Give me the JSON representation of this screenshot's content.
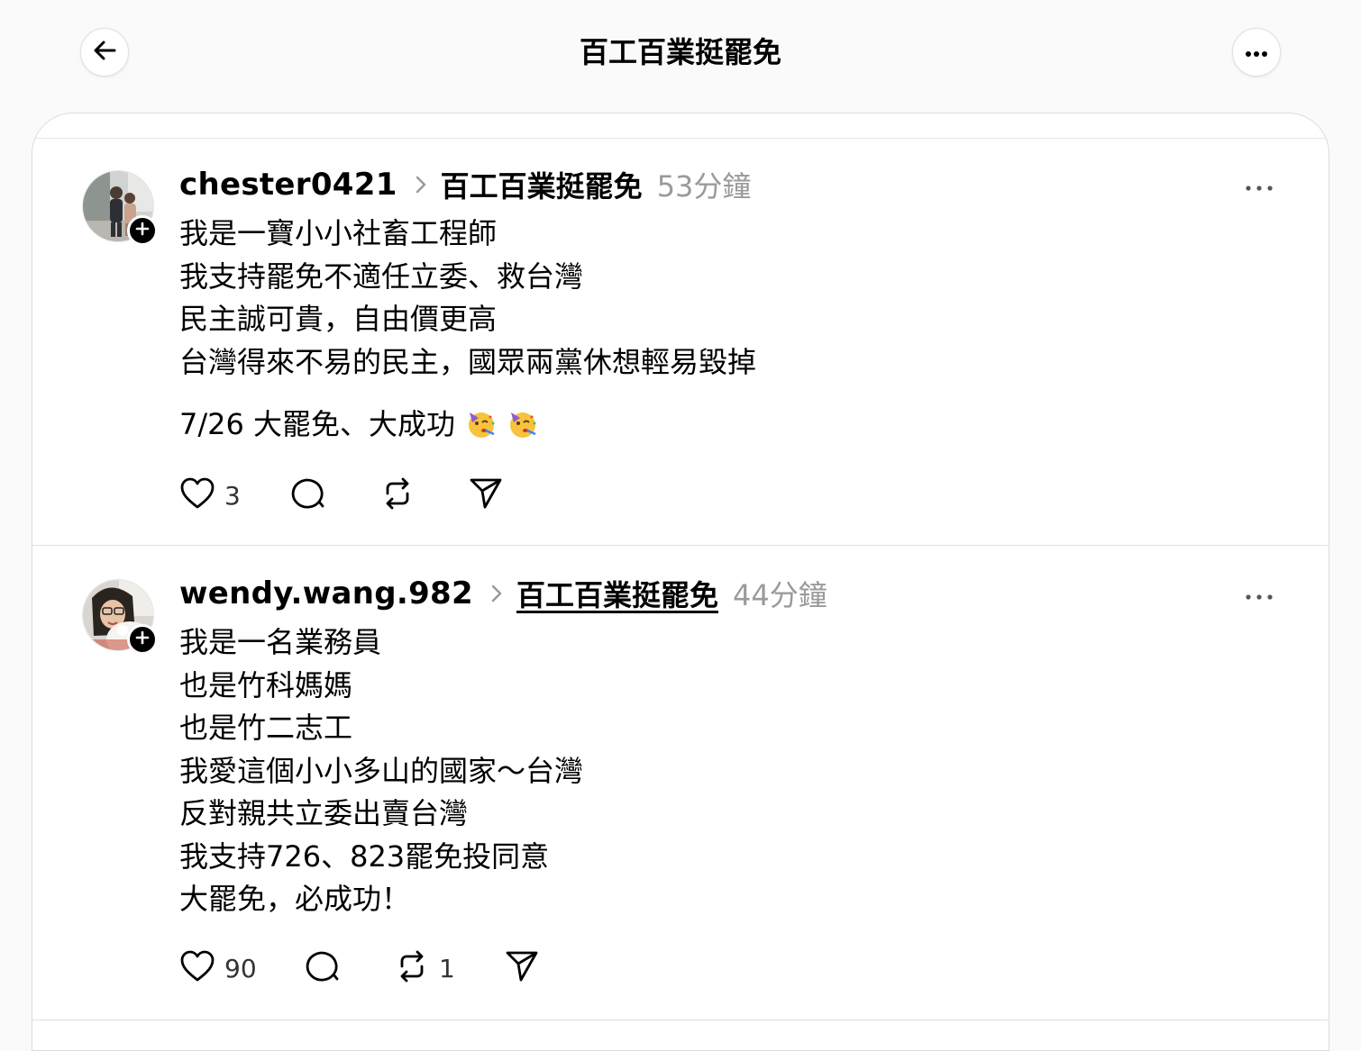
{
  "header": {
    "title": "百工百業挺罷免"
  },
  "posts": [
    {
      "username": "chester0421",
      "community": "百工百業挺罷免",
      "time": "53分鐘",
      "lines": [
        "我是一寶小小社畜工程師",
        "我支持罷免不適任立委、救台灣",
        "民主誠可貴，自由價更高",
        "台灣得來不易的民主，國眾兩黨休想輕易毀掉"
      ],
      "extra_line": "7/26 大罷免、大成功",
      "extra_emojis": [
        "partying-face-emoji",
        "partying-face-emoji"
      ],
      "likes": "3",
      "comments": "",
      "reposts": "",
      "shares": ""
    },
    {
      "username": "wendy.wang.982",
      "community": "百工百業挺罷免",
      "time": "44分鐘",
      "lines": [
        "我是一名業務員",
        "也是竹科媽媽",
        "也是竹二志工",
        "我愛這個小小多山的國家～台灣",
        "反對親共立委出賣台灣",
        "我支持726、823罷免投同意",
        "大罷免，必成功！"
      ],
      "likes": "90",
      "comments": "",
      "reposts": "1",
      "shares": ""
    }
  ],
  "colors": {
    "background": "#fafafa",
    "card": "#ffffff",
    "muted": "#9a9a9a",
    "text": "#000000"
  }
}
